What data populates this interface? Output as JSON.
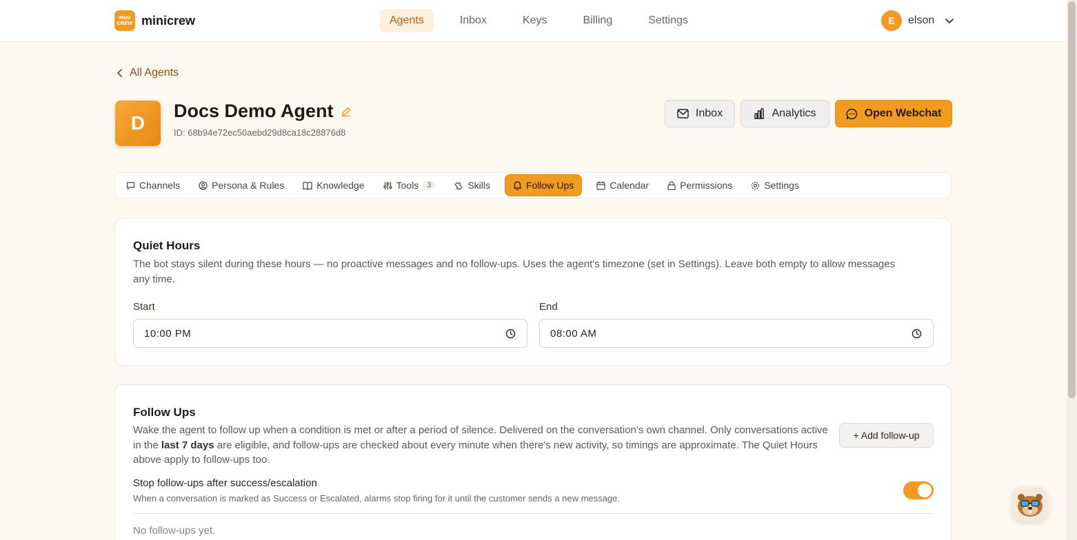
{
  "brand": {
    "logo_line1": "Mini",
    "logo_line2": "CREW",
    "name": "minicrew"
  },
  "nav": [
    {
      "label": "Agents",
      "active": true
    },
    {
      "label": "Inbox"
    },
    {
      "label": "Keys"
    },
    {
      "label": "Billing"
    },
    {
      "label": "Settings"
    }
  ],
  "user": {
    "initial": "E",
    "name": "elson"
  },
  "back": {
    "label": "All Agents"
  },
  "agent": {
    "initial": "D",
    "name": "Docs Demo Agent",
    "id_text": "ID: 68b94e72ec50aebd29d8ca18c28876d8"
  },
  "header_buttons": {
    "inbox": "Inbox",
    "analytics": "Analytics",
    "open_webchat": "Open Webchat"
  },
  "tabs": [
    {
      "label": "Channels",
      "icon": "message-icon"
    },
    {
      "label": "Persona & Rules",
      "icon": "user-circle-icon"
    },
    {
      "label": "Knowledge",
      "icon": "book-icon"
    },
    {
      "label": "Tools",
      "icon": "sliders-icon",
      "count": "3"
    },
    {
      "label": "Skills",
      "icon": "puzzle-icon"
    },
    {
      "label": "Follow Ups",
      "icon": "bell-icon",
      "active": true
    },
    {
      "label": "Calendar",
      "icon": "calendar-icon"
    },
    {
      "label": "Permissions",
      "icon": "lock-icon"
    },
    {
      "label": "Settings",
      "icon": "gear-icon"
    }
  ],
  "quiet_hours": {
    "title": "Quiet Hours",
    "description": "The bot stays silent during these hours — no proactive messages and no follow-ups. Uses the agent's timezone (set in Settings). Leave both empty to allow messages any time.",
    "start_label": "Start",
    "start_value": "10:00 PM",
    "end_label": "End",
    "end_value": "08:00 AM"
  },
  "follow_ups": {
    "title": "Follow Ups",
    "desc_part1": "Wake the agent to follow up when a condition is met or after a period of silence. Delivered on the conversation's own channel. Only conversations active in the ",
    "desc_bold": "last 7 days",
    "desc_part2": " are eligible, and follow-ups are checked about every minute when there's new activity, so timings are approximate. The Quiet Hours above apply to follow-ups too.",
    "add_button": "+ Add follow-up",
    "stop_title": "Stop follow-ups after success/escalation",
    "stop_desc": "When a conversation is marked as Success or Escalated, alarms stop firing for it until the customer sends a new message.",
    "stop_enabled": true,
    "empty_text": "No follow-ups yet."
  },
  "colors": {
    "accent": "#f29b22",
    "background": "#fdf8f0",
    "link": "#8a4b0f"
  }
}
